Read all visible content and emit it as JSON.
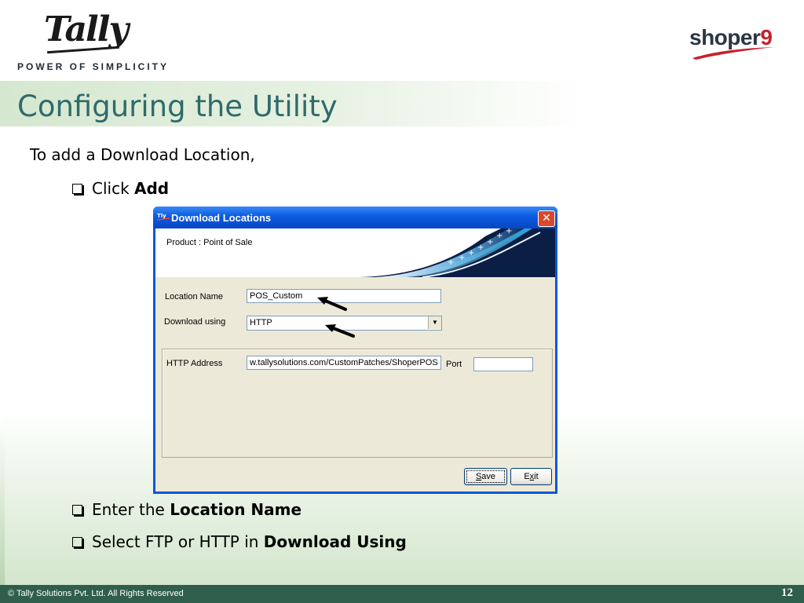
{
  "header": {
    "logo_text": "Tally",
    "tagline": "POWER OF SIMPLICITY",
    "shoper_text": "shoper",
    "shoper_number": "9"
  },
  "slide": {
    "title": "Configuring the Utility",
    "intro": "To add a Download Location,",
    "bullets": [
      {
        "prefix": "Click ",
        "bold": "Add",
        "suffix": ""
      },
      {
        "prefix": "Enter the ",
        "bold": "Location Name",
        "suffix": ""
      },
      {
        "prefix": "Select FTP or HTTP in ",
        "bold": "Download Using",
        "suffix": ""
      }
    ]
  },
  "dialog": {
    "title": "Download Locations",
    "icon": "tally-app-icon",
    "close_symbol": "✕",
    "product_label": "Product : Point of Sale",
    "location_name_label": "Location Name",
    "location_name_value": "POS_Custom",
    "download_using_label": "Download using",
    "download_using_value": "HTTP",
    "http_address_label": "HTTP Address",
    "http_address_value": "w.tallysolutions.com/CustomPatches/ShoperPOS",
    "port_label": "Port",
    "port_value": "",
    "save_button": {
      "mnemonic": "S",
      "rest": "ave"
    },
    "exit_button": {
      "before": "E",
      "mnemonic": "x",
      "after": "it"
    }
  },
  "footer": {
    "copyright": "© Tally Solutions Pvt. Ltd. All Rights Reserved",
    "page_number": "12"
  },
  "colors": {
    "title": "#2e6b6b",
    "footer_bg": "#2f5f4c",
    "xp_blue": "#0a58d6",
    "close_red": "#d9482b",
    "brand_red": "#c8202c"
  }
}
